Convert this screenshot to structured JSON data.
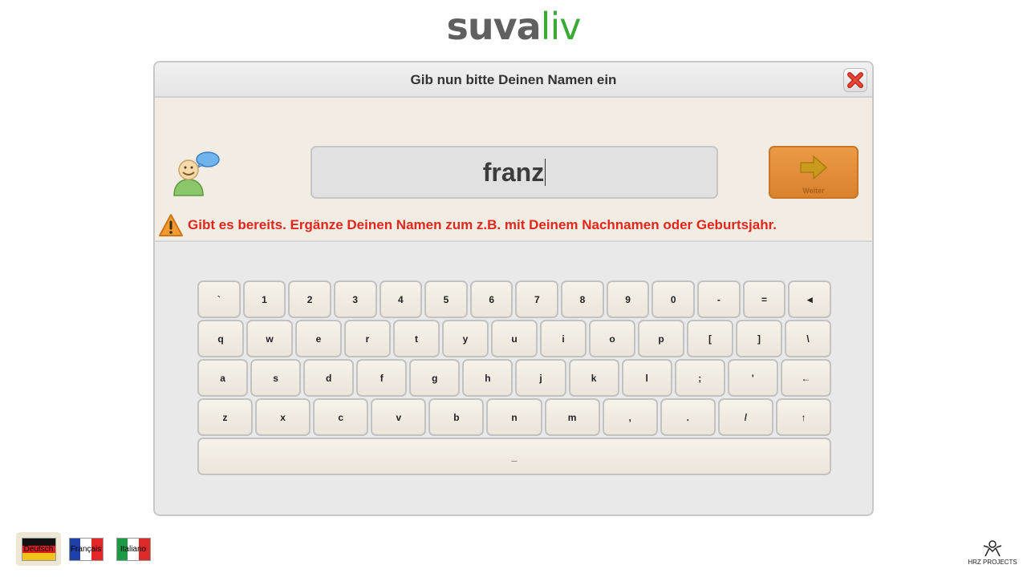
{
  "logo": {
    "part1": "suva",
    "part2": "liv"
  },
  "dialog": {
    "title": "Gib nun bitte Deinen Namen ein",
    "name_value": "franz",
    "next_label": "Weiter",
    "warning": "Gibt es bereits. Ergänze Deinen Namen zum z.B. mit Deinem Nachnamen oder Geburtsjahr."
  },
  "keyboard": {
    "row1": [
      "`",
      "1",
      "2",
      "3",
      "4",
      "5",
      "6",
      "7",
      "8",
      "9",
      "0",
      "-",
      "=",
      "◄"
    ],
    "row2": [
      "q",
      "w",
      "e",
      "r",
      "t",
      "y",
      "u",
      "i",
      "o",
      "p",
      "[",
      "]",
      "\\"
    ],
    "row3": [
      "a",
      "s",
      "d",
      "f",
      "g",
      "h",
      "j",
      "k",
      "l",
      ";",
      "'",
      "←"
    ],
    "row4": [
      "z",
      "x",
      "c",
      "v",
      "b",
      "n",
      "m",
      ",",
      ".",
      "/",
      "↑"
    ],
    "space": "_"
  },
  "languages": [
    {
      "label": "Deutsch",
      "active": true
    },
    {
      "label": "Français",
      "active": false
    },
    {
      "label": "Italiano",
      "active": false
    }
  ],
  "footer": {
    "brand": "HRZ PROJECTS"
  },
  "colors": {
    "logo_gray": "#606060",
    "logo_green": "#3aaa35",
    "accent_orange": "#e08a35",
    "warning_red": "#e1261c",
    "panel_beige": "#f2ece2"
  },
  "icons": {
    "close": "close-icon",
    "avatar": "user-speech-icon",
    "next": "arrow-right-icon",
    "warning": "warning-triangle-icon",
    "brand": "hrz-logo-icon"
  }
}
